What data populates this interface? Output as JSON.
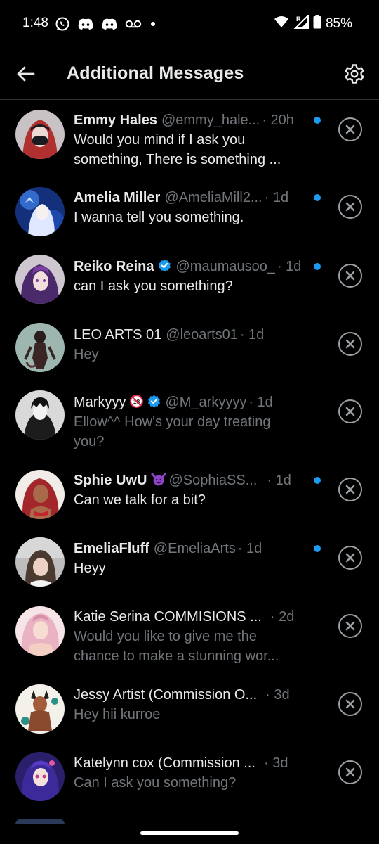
{
  "status_bar": {
    "time": "1:48",
    "battery": "85%",
    "icons": [
      "whatsapp-icon",
      "discord-icon",
      "discord-icon",
      "voicemail-icon",
      "dot-icon",
      "wifi-icon",
      "signal-icon",
      "battery-icon"
    ]
  },
  "header": {
    "title": "Additional Messages",
    "back_icon": "arrow-left-icon",
    "settings_icon": "gear-icon"
  },
  "colors": {
    "background": "#000000",
    "primary_text": "#e7e9ea",
    "secondary_text": "#71767b",
    "accent": "#1d9bf0"
  },
  "messages": [
    {
      "name": "Emmy Hales",
      "handle": "@emmy_hale...",
      "time": "· 20h",
      "preview": [
        "Would you mind if I ask you",
        "something, There is something ..."
      ],
      "unread": true,
      "verified": false
    },
    {
      "name": "Amelia Miller",
      "handle": "@AmeliaMill2...",
      "time": "· 1d",
      "preview": [
        "I wanna tell you something."
      ],
      "unread": true,
      "verified": false
    },
    {
      "name": "Reiko Reina",
      "handle": "@maumausoo_",
      "time": "· 1d",
      "preview": [
        "can I ask you something?"
      ],
      "unread": true,
      "verified": true
    },
    {
      "name": "LEO ARTS 01",
      "handle": "@leoarts01",
      "time": "· 1d",
      "preview": [
        "Hey"
      ],
      "unread": false,
      "verified": false
    },
    {
      "name": "Markyyy",
      "handle": "@M_arkyyyy",
      "time": "· 1d",
      "preview": [
        "Ellow^^ How's your day treating",
        "you?"
      ],
      "unread": false,
      "verified": true,
      "emoji": "18"
    },
    {
      "name": "Sphie UwU",
      "handle": "@SophiaSS...",
      "time": "· 1d",
      "preview": [
        "Can we talk for a bit?"
      ],
      "unread": true,
      "verified": false,
      "emoji": "smiling-imp"
    },
    {
      "name": "EmeliaFluff",
      "handle": "@EmeliaArts",
      "time": "· 1d",
      "preview": [
        "Heyy"
      ],
      "unread": true,
      "verified": false
    },
    {
      "name": "Katie Serina COMMISIONS ...",
      "handle": "",
      "time": "· 2d",
      "preview": [
        "Would you like to give me the",
        "chance to make a stunning wor..."
      ],
      "unread": false,
      "verified": false
    },
    {
      "name": "Jessy Artist (Commission O...",
      "handle": "",
      "time": "· 3d",
      "preview": [
        "Hey hii kurroe"
      ],
      "unread": false,
      "verified": false
    },
    {
      "name": "Katelynn cox (Commission ...",
      "handle": "",
      "time": "· 3d",
      "preview": [
        "Can I ask you something?"
      ],
      "unread": false,
      "verified": false
    }
  ]
}
